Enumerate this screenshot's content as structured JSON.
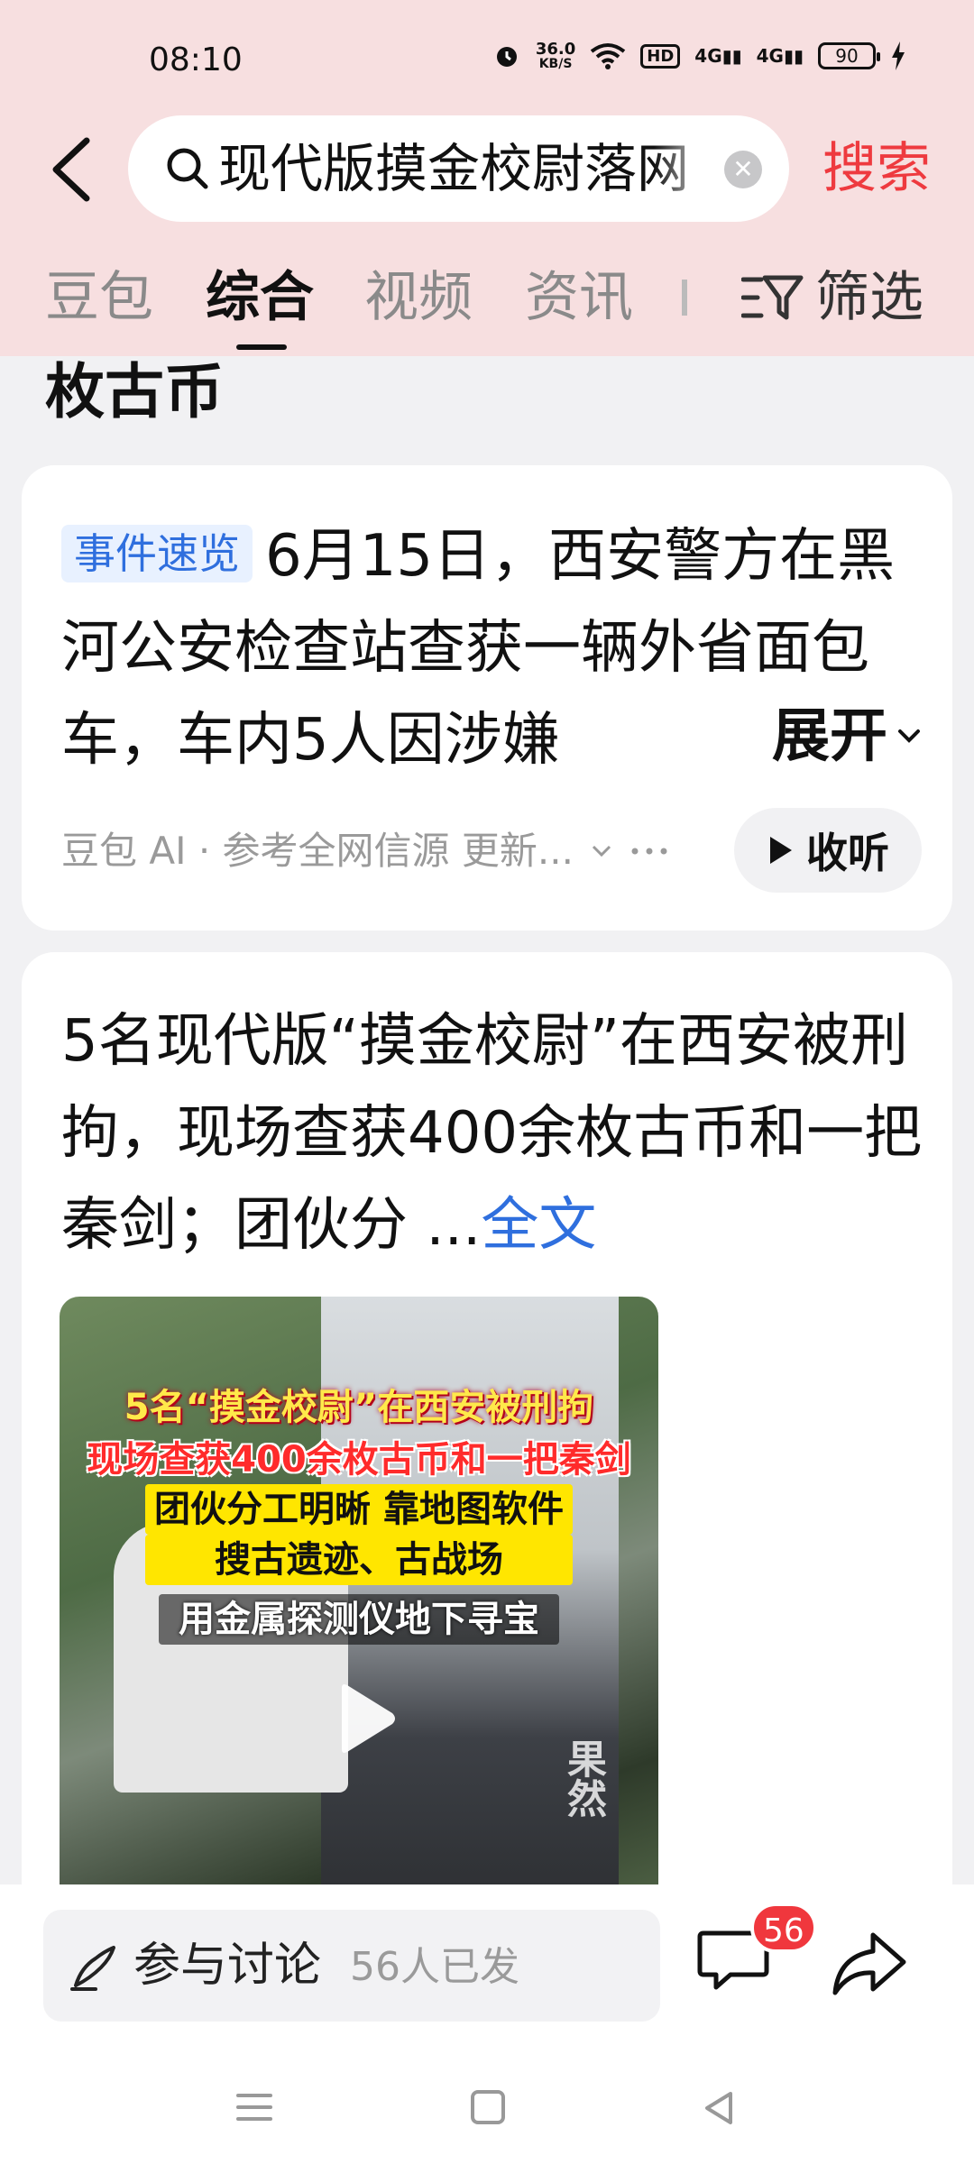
{
  "status_bar": {
    "time": "08:10",
    "speed_value": "36.0",
    "speed_unit": "KB/S",
    "hd": "HD",
    "signal1": "4G",
    "signal2": "4G",
    "battery": "90"
  },
  "search": {
    "query": "现代版摸金校尉落网",
    "search_button": "搜索"
  },
  "tabs": {
    "items": [
      "豆包",
      "综合",
      "视频",
      "资讯"
    ],
    "active_index": 1,
    "filter_label": "筛选"
  },
  "previous_tail": "枚古币",
  "ai_card": {
    "tag": "事件速览",
    "text": "6月15日，西安警方在黑河公安检查站查获一辆外省面包车，车内5人因涉嫌",
    "expand_label": "展开",
    "meta": "豆包 AI · 参考全网信源 更新...",
    "listen_label": "收听"
  },
  "article_card": {
    "title": "5名现代版“摸金校尉”在西安被刑拘，现场查获400余枚古币和一把秦剑；团伙分 ...",
    "fulltext_label": "全文",
    "video_caption_1": "5名“摸金校尉”在西安被刑拘",
    "video_caption_2": "现场查获400余枚古币和一把秦剑",
    "video_caption_3": "团伙分工明晰 靠地图软件",
    "video_caption_4": "搜古遗迹、古战场",
    "video_caption_5": "用金属探测仪地下寻宝",
    "watermark": "果然"
  },
  "bottom_bar": {
    "comment_label": "参与讨论",
    "comment_count": "56人已发",
    "badge_count": "56"
  },
  "colors": {
    "accent_red": "#ee3a3f",
    "link_blue": "#2f6fde",
    "header_bg": "#f7dfe0"
  }
}
